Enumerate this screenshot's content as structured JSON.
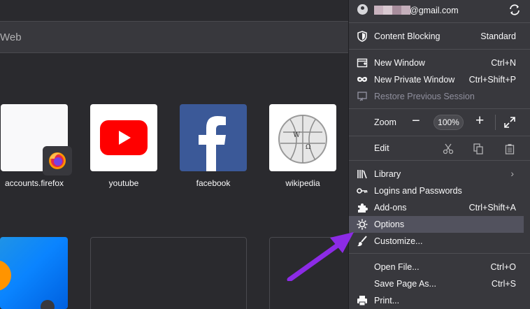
{
  "newtab": {
    "search_placeholder": "Web",
    "tiles": [
      {
        "label": "accounts.firefox"
      },
      {
        "label": "youtube"
      },
      {
        "label": "facebook"
      },
      {
        "label": "wikipedia"
      }
    ]
  },
  "menu": {
    "account_email": "@gmail.com",
    "items": [
      {
        "label": "Content Blocking",
        "shortcut": "Standard"
      },
      {
        "label": "New Window",
        "shortcut": "Ctrl+N"
      },
      {
        "label": "New Private Window",
        "shortcut": "Ctrl+Shift+P"
      },
      {
        "label": "Restore Previous Session",
        "shortcut": ""
      },
      {
        "label": "Zoom",
        "shortcut": ""
      },
      {
        "label": "Edit",
        "shortcut": ""
      },
      {
        "label": "Library",
        "shortcut": ""
      },
      {
        "label": "Logins and Passwords",
        "shortcut": ""
      },
      {
        "label": "Add-ons",
        "shortcut": "Ctrl+Shift+A"
      },
      {
        "label": "Options",
        "shortcut": ""
      },
      {
        "label": "Customize...",
        "shortcut": ""
      },
      {
        "label": "Open File...",
        "shortcut": "Ctrl+O"
      },
      {
        "label": "Save Page As...",
        "shortcut": "Ctrl+S"
      },
      {
        "label": "Print...",
        "shortcut": ""
      }
    ],
    "zoom": {
      "minus": "−",
      "value": "100%",
      "plus": "+"
    }
  },
  "colors": {
    "panel_bg": "#38383d",
    "highlight": "#52525e",
    "arrow": "#8c2be6",
    "youtube_red": "#ff0000",
    "facebook_blue": "#3b5998"
  }
}
